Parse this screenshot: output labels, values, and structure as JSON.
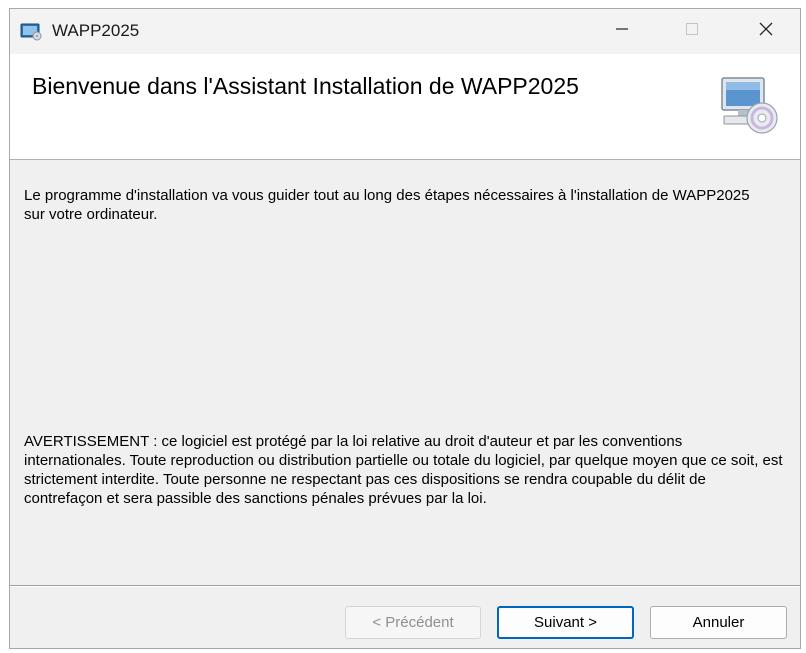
{
  "window": {
    "title": "WAPP2025"
  },
  "header": {
    "title": "Bienvenue dans l'Assistant Installation de WAPP2025"
  },
  "body": {
    "intro": "Le programme d'installation va vous guider tout au long des étapes nécessaires à l'installation de WAPP2025 sur votre ordinateur.",
    "warning": "AVERTISSEMENT : ce logiciel est protégé par la loi relative au droit d'auteur et par les conventions internationales. Toute reproduction ou distribution partielle ou totale du logiciel, par quelque moyen que ce soit, est strictement interdite. Toute personne ne respectant pas ces dispositions se rendra coupable du délit de contrefaçon et sera passible des sanctions pénales prévues par la loi."
  },
  "buttons": {
    "previous": "< Précédent",
    "next": "Suivant >",
    "cancel": "Annuler"
  },
  "icons": {
    "app": "installer-app-icon",
    "setup": "computer-disc-icon",
    "minimize": "minimize-icon",
    "maximize": "maximize-icon",
    "close": "close-icon"
  },
  "colors": {
    "default_button_border": "#0067c0",
    "disabled_text": "#8f8f8f"
  }
}
